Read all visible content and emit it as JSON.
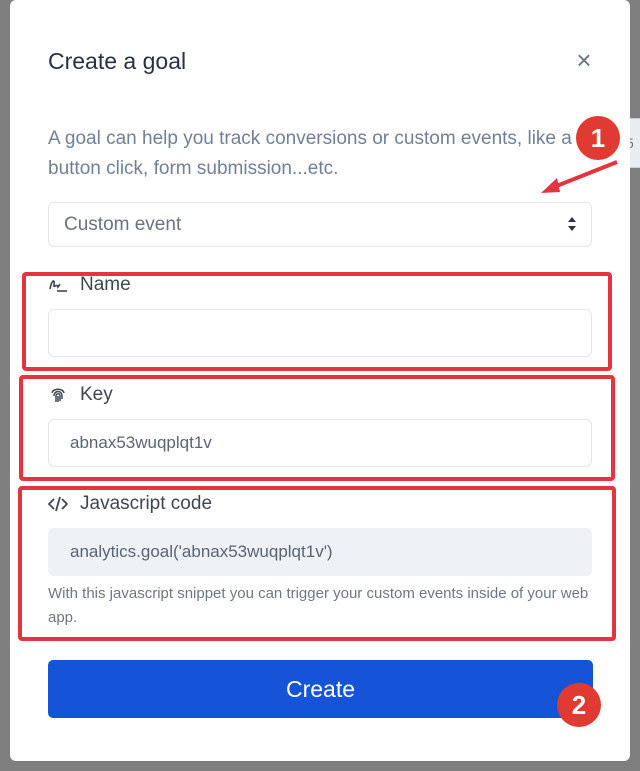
{
  "modal": {
    "title": "Create a goal",
    "close_symbol": "×",
    "description": "A goal can help you track conversions or custom events, like a button click, form submission...etc.",
    "goal_type": {
      "selected": "Custom event"
    },
    "name_field": {
      "label": "Name",
      "value": "",
      "icon": "signature-icon"
    },
    "key_field": {
      "label": "Key",
      "value": "abnax53wuqplqt1v",
      "icon": "fingerprint-icon"
    },
    "code_field": {
      "label": "Javascript code",
      "value": "analytics.goal('abnax53wuqplqt1v')",
      "help": "With this javascript snippet you can trigger your custom events inside of your web app.",
      "icon": "code-icon"
    },
    "create_button": "Create"
  },
  "background": {
    "partial_text": "5"
  },
  "annotations": [
    {
      "number": "1"
    },
    {
      "number": "2"
    }
  ],
  "colors": {
    "primary": "#1554d6",
    "annotation_red": "#e3343f"
  }
}
